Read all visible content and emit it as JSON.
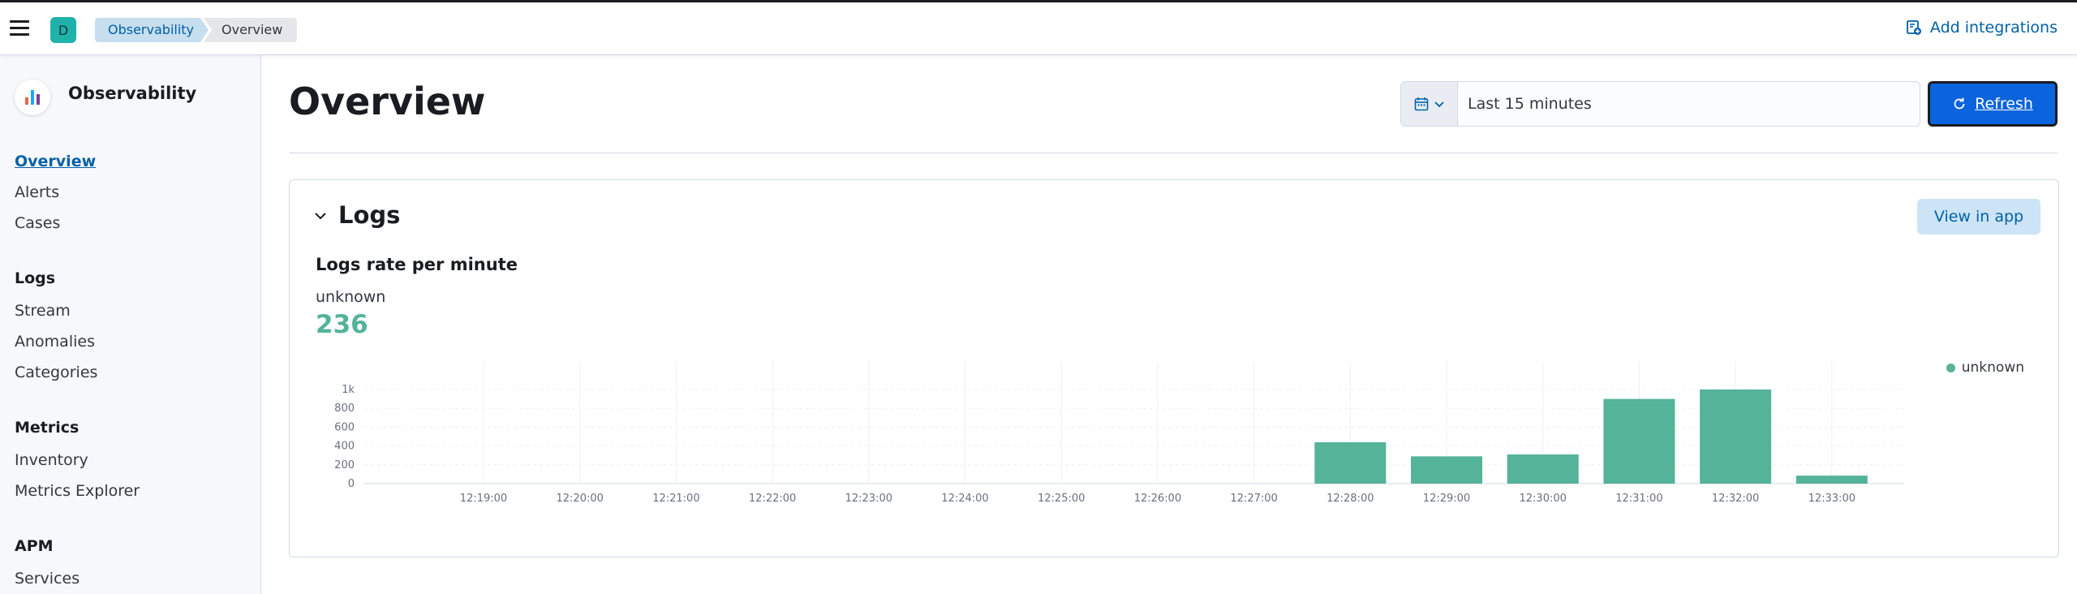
{
  "header": {
    "space_initial": "D",
    "breadcrumbs": [
      "Observability",
      "Overview"
    ],
    "add_integrations_label": "Add integrations"
  },
  "sidebar": {
    "brand_title": "Observability",
    "items": [
      {
        "label": "Overview",
        "active": true
      },
      {
        "label": "Alerts"
      },
      {
        "label": "Cases"
      }
    ],
    "sections": [
      {
        "heading": "Logs",
        "items": [
          "Stream",
          "Anomalies",
          "Categories"
        ]
      },
      {
        "heading": "Metrics",
        "items": [
          "Inventory",
          "Metrics Explorer"
        ]
      },
      {
        "heading": "APM",
        "items": [
          "Services"
        ]
      }
    ]
  },
  "main": {
    "title": "Overview",
    "date_range": "Last 15 minutes",
    "refresh_label": "Refresh"
  },
  "logs_panel": {
    "title": "Logs",
    "view_in_app_label": "View in app",
    "chart_title": "Logs rate per minute",
    "stat_label": "unknown",
    "stat_value": "236"
  },
  "colors": {
    "accent": "#0b64dd",
    "series": "#54b399",
    "link": "#0061a6"
  },
  "chart_data": {
    "type": "bar",
    "title": "Logs rate per minute",
    "categories": [
      "12:19:00",
      "12:20:00",
      "12:21:00",
      "12:22:00",
      "12:23:00",
      "12:24:00",
      "12:25:00",
      "12:26:00",
      "12:27:00",
      "12:28:00",
      "12:29:00",
      "12:30:00",
      "12:31:00",
      "12:32:00",
      "12:33:00"
    ],
    "series": [
      {
        "name": "unknown",
        "values": [
          0,
          0,
          0,
          0,
          0,
          0,
          0,
          0,
          0,
          440,
          290,
          310,
          900,
          1000,
          85
        ]
      }
    ],
    "y_ticks": [
      0,
      200,
      400,
      600,
      800,
      1000
    ],
    "y_tick_labels": [
      "0",
      "200",
      "400",
      "600",
      "800",
      "1k"
    ],
    "ylim": [
      0,
      1000
    ],
    "grid": true,
    "legend": "right"
  }
}
